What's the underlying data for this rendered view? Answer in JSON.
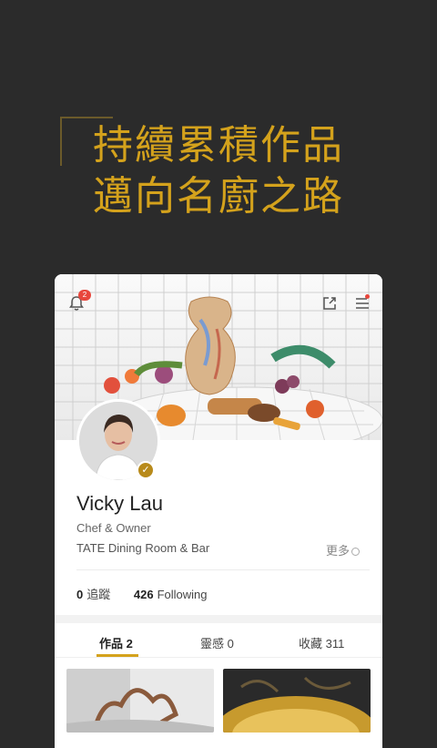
{
  "headline": {
    "line1": "持續累積作品",
    "line2": "邁向名廚之路"
  },
  "topbar": {
    "notification_icon": "bell-icon",
    "notification_count": "2",
    "share_icon": "share-icon",
    "menu_icon": "menu-icon"
  },
  "profile": {
    "name": "Vicky Lau",
    "title": "Chef & Owner",
    "restaurant": "TATE Dining Room & Bar",
    "more_label": "更多"
  },
  "stats": {
    "followers_count": "0",
    "followers_label": "追蹤",
    "following_count": "426",
    "following_label": "Following"
  },
  "tabs": [
    {
      "label": "作品 2"
    },
    {
      "label": "靈感 0"
    },
    {
      "label": "收藏 311"
    }
  ],
  "colors": {
    "accent": "#d4a21c",
    "background": "#2b2b2b",
    "badge": "#e8463c"
  }
}
